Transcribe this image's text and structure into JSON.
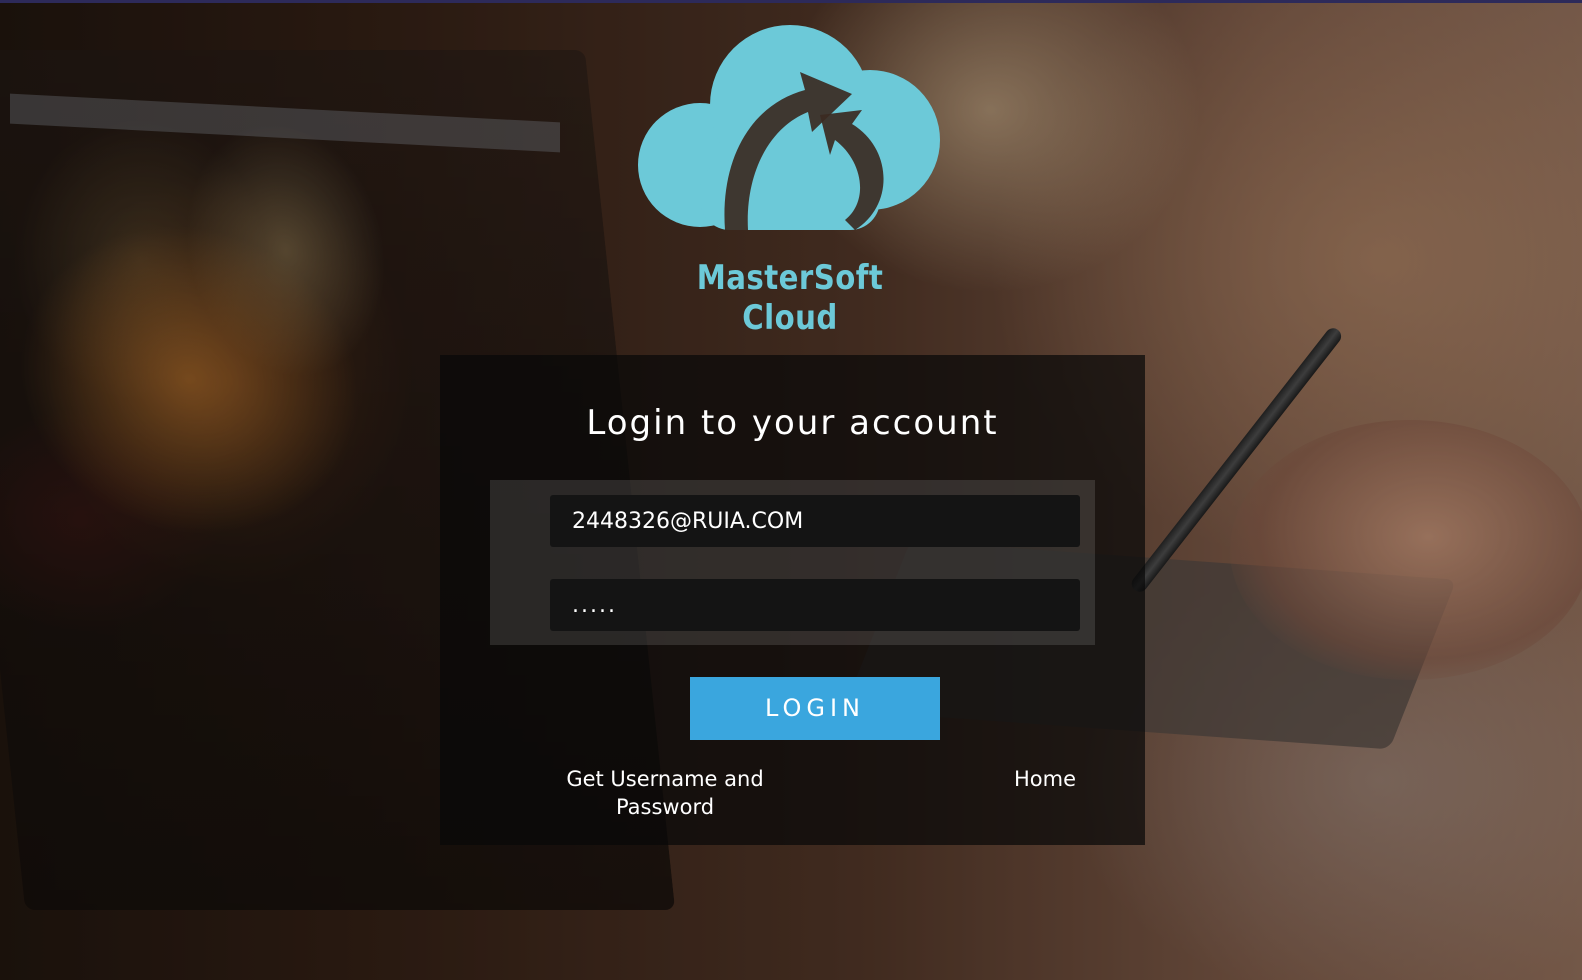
{
  "brand": {
    "name": "MasterSoft Cloud",
    "logo_icon": "cloud-arrow-icon",
    "color": "#6cc9d8"
  },
  "login": {
    "title": "Login to your account",
    "username_value": "2448326@RUIA.COM",
    "password_mask": ".....",
    "button_label": "LOGIN",
    "button_color": "#3aa6de",
    "links": {
      "get_credentials": "Get Username and Password",
      "home": "Home"
    }
  }
}
